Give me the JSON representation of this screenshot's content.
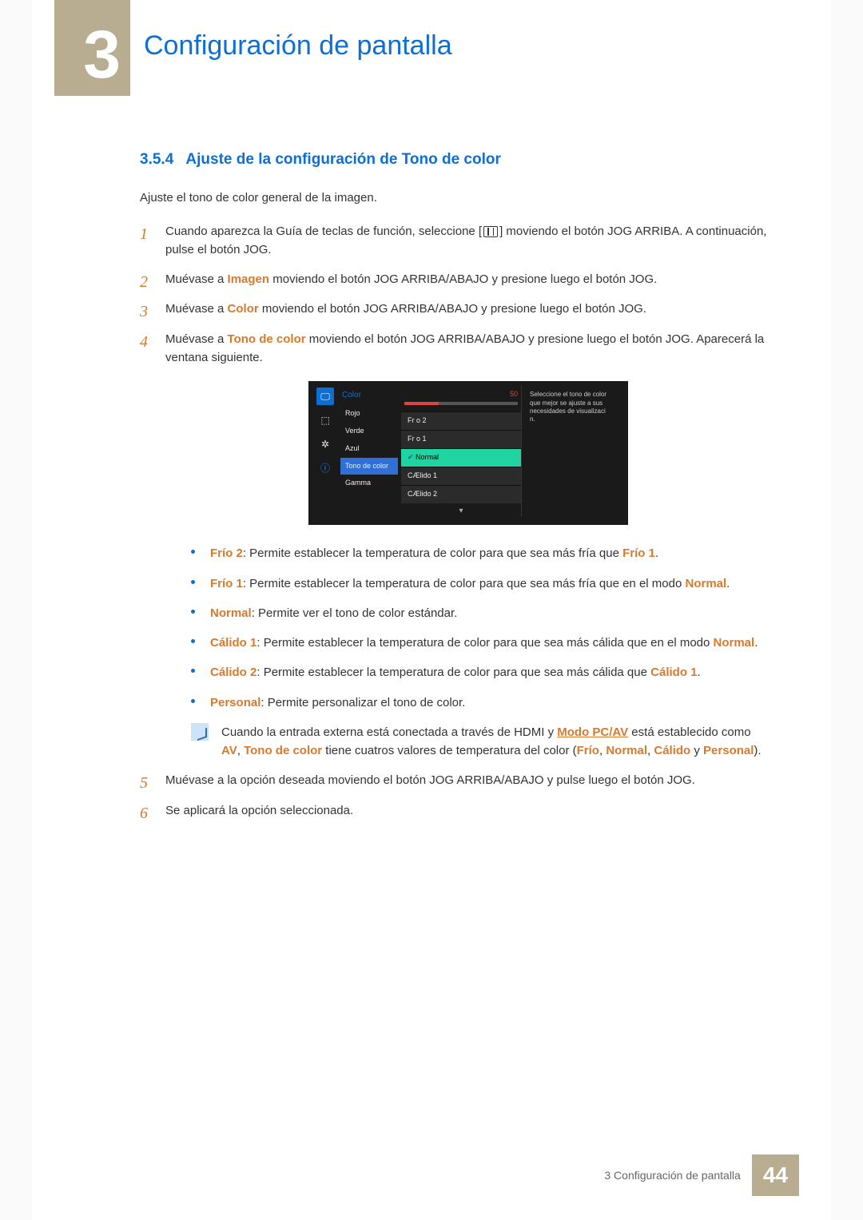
{
  "chapter": {
    "number": "3",
    "title": "Configuración de pantalla"
  },
  "section": {
    "number": "3.5.4",
    "title": "Ajuste de la configuración de Tono de color"
  },
  "intro": "Ajuste el tono de color general de la imagen.",
  "steps": {
    "s1a": "Cuando aparezca la Guía de teclas de función, seleccione [",
    "s1b": "] moviendo el botón JOG ARRIBA. A continuación, pulse el botón JOG.",
    "s2a": "Muévase a ",
    "s2b": "Imagen",
    "s2c": " moviendo el botón JOG ARRIBA/ABAJO y presione luego el botón JOG.",
    "s3a": "Muévase a ",
    "s3b": "Color",
    "s3c": " moviendo el botón JOG ARRIBA/ABAJO y presione luego el botón JOG.",
    "s4a": "Muévase a ",
    "s4b": "Tono de color",
    "s4c": " moviendo el botón JOG ARRIBA/ABAJO y presione luego el botón JOG. Aparecerá la ventana siguiente.",
    "s5": "Muévase a la opción deseada moviendo el botón JOG ARRIBA/ABAJO y pulse luego el botón JOG.",
    "s6": "Se aplicará la opción seleccionada."
  },
  "osd": {
    "title": "Color",
    "items": [
      "Rojo",
      "Verde",
      "Azul",
      "Tono de color",
      "Gamma"
    ],
    "slider_value": "50",
    "options": [
      "Fr o 2",
      "Fr o 1",
      "Normal",
      "CÆlido 1",
      "CÆlido 2"
    ],
    "help": "Seleccione el tono de color que mejor se ajuste a sus necesidades de visualizaci n."
  },
  "bullets": {
    "frio2_k": "Frío 2",
    "frio2_t": ": Permite establecer la temperatura de color para que sea más fría que ",
    "frio2_r": "Frío 1",
    "frio2_end": ".",
    "frio1_k": "Frío 1",
    "frio1_t": ": Permite establecer la temperatura de color para que sea más fría que en el modo ",
    "frio1_r": "Normal",
    "frio1_end": ".",
    "normal_k": "Normal",
    "normal_t": ": Permite ver el tono de color estándar.",
    "cal1_k": "Cálido 1",
    "cal1_t": ": Permite establecer la temperatura de color para que sea más cálida que en el modo ",
    "cal1_r": "Normal",
    "cal1_end": ".",
    "cal2_k": "Cálido 2",
    "cal2_t": ": Permite establecer la temperatura de color para que sea más cálida que ",
    "cal2_r": "Cálido 1",
    "cal2_end": ".",
    "pers_k": "Personal",
    "pers_t": ": Permite personalizar el tono de color."
  },
  "note": {
    "t1": "Cuando la entrada externa está conectada a través de HDMI y ",
    "modo": "Modo PC/AV",
    "t2": " está establecido como ",
    "av": "AV",
    "t3": ", ",
    "tono": "Tono de color",
    "t4": " tiene cuatros valores de temperatura del color (",
    "frio": "Frío",
    "c1": ", ",
    "normal": "Normal",
    "c2": ", ",
    "calido": "Cálido",
    "c3": " y ",
    "personal": "Personal",
    "t5": ")."
  },
  "footer": {
    "label": "3 Configuración de pantalla",
    "page": "44"
  }
}
